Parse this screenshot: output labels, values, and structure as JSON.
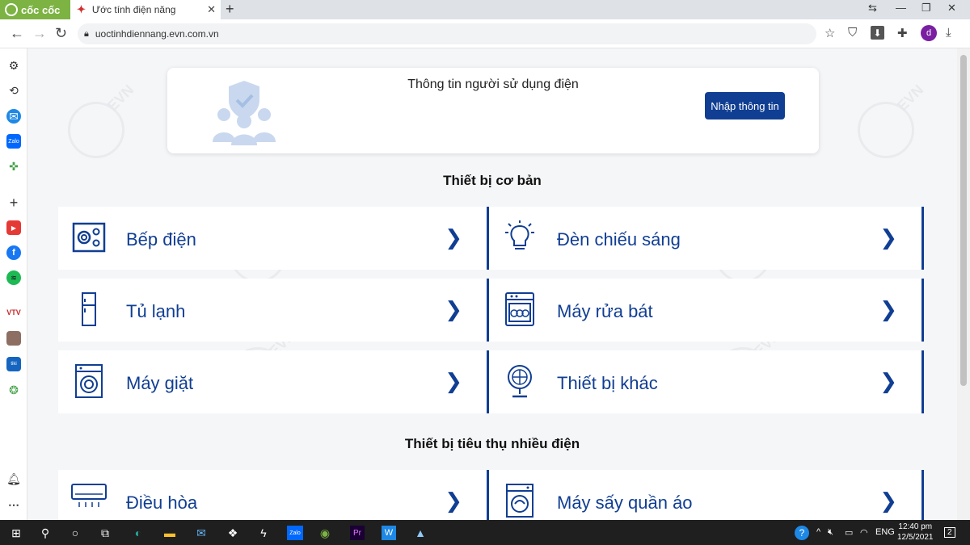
{
  "browser": {
    "brand": "cốc cốc",
    "tab_title": "Ước tính điện năng",
    "url": "uoctinhdiennang.evn.com.vn",
    "profile_letter": "d"
  },
  "user_panel": {
    "title": "Thông tin người sử dụng điện",
    "button": "Nhập thông tin"
  },
  "sections": {
    "basic": "Thiết bị cơ bản",
    "heavy": "Thiết bị tiêu thụ nhiều điện"
  },
  "devices": {
    "stove": "Bếp điện",
    "lighting": "Đèn chiếu sáng",
    "fridge": "Tủ lạnh",
    "dishwasher": "Máy rửa bát",
    "washer": "Máy giặt",
    "other": "Thiết bị khác",
    "aircon": "Điều hòa",
    "dryer": "Máy sấy quần áo"
  },
  "taskbar": {
    "lang": "ENG",
    "time": "12:40 pm",
    "date": "12/5/2021",
    "notifications": "2"
  },
  "colors": {
    "accent": "#103e93",
    "brand_green": "#7cb342"
  }
}
